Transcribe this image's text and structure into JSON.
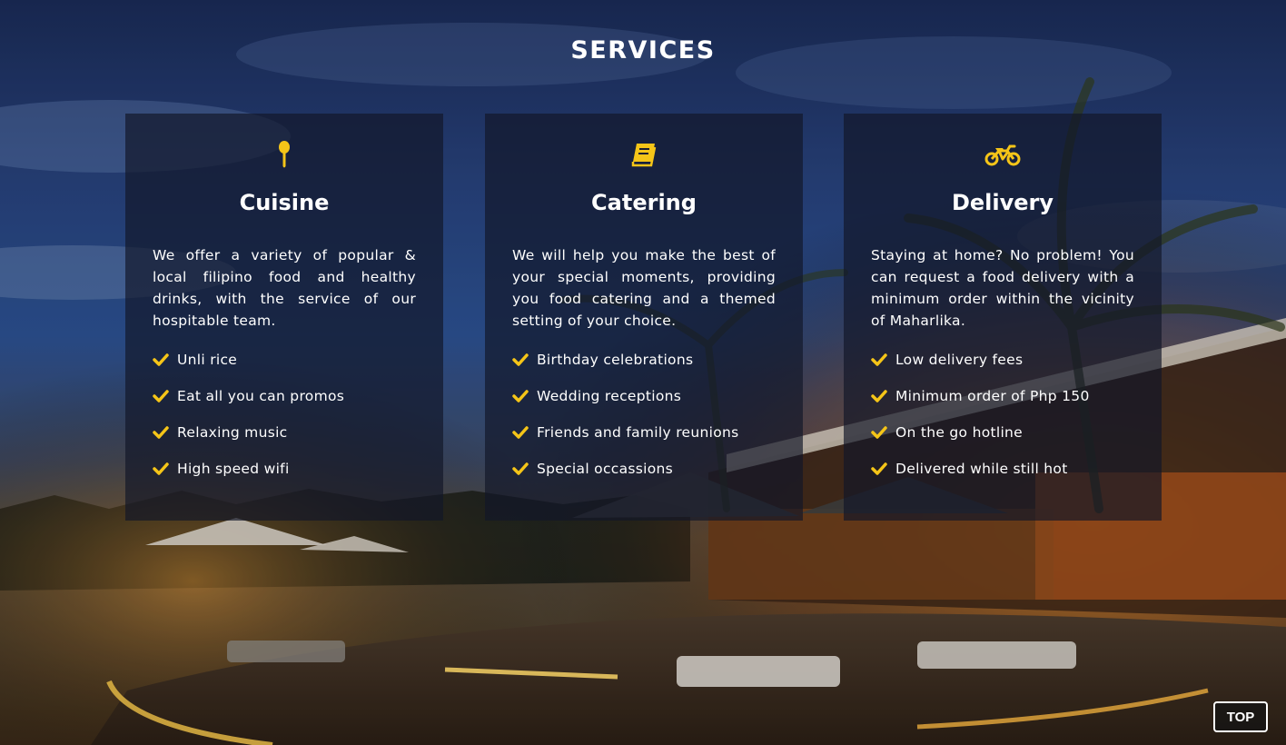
{
  "section": {
    "title": "SERVICES"
  },
  "colors": {
    "accent": "#f5c518",
    "card_bg": "rgba(18,22,40,0.68)",
    "text": "#ffffff"
  },
  "cards": [
    {
      "icon": "spoon-icon",
      "title": "Cuisine",
      "description": "We offer a variety of popular & local filipino food and healthy drinks, with the service of our hospitable team.",
      "features": [
        "Unli rice",
        "Eat all you can promos",
        "Relaxing music",
        "High speed wifi"
      ]
    },
    {
      "icon": "book-icon",
      "title": "Catering",
      "description": "We will help you make the best of your special moments, providing you food catering and a themed setting of your choice.",
      "features": [
        "Birthday celebrations",
        "Wedding receptions",
        "Friends and family reunions",
        "Special occassions"
      ]
    },
    {
      "icon": "motorcycle-icon",
      "title": "Delivery",
      "description": "Staying at home? No problem! You can request a food delivery with a minimum order within the vicinity of Maharlika.",
      "features": [
        "Low delivery fees",
        "Minimum order of Php 150",
        "On the go hotline",
        "Delivered while still hot"
      ]
    }
  ],
  "top_button": {
    "label": "TOP"
  }
}
